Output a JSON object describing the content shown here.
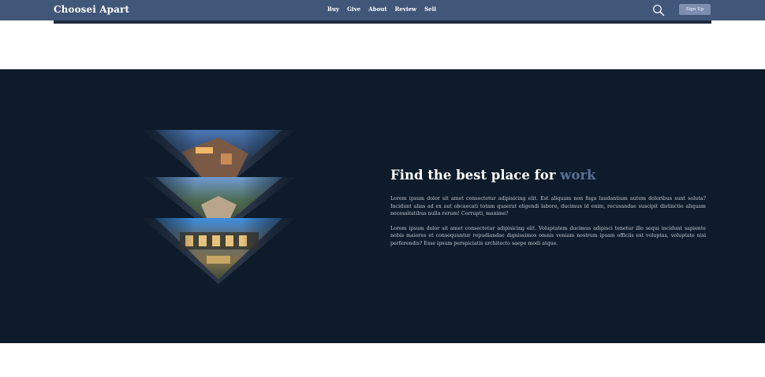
{
  "navbar": {
    "brand": "Choosei Apart",
    "links": [
      "Buy",
      "Give",
      "About",
      "Review",
      "Sell"
    ],
    "signup_label": "Sign Up",
    "icon": "search-icon"
  },
  "hero": {
    "heading_main": "Find the best place for ",
    "heading_accent": "work",
    "paragraph_1": "Lorem ipsum dolor sit amet consectetur adipisicing elit. Est aliquam non fuga laudantium autem doloribus sunt soluta? Incidunt alias ad ex aut obcaecati totam quaerat eligendi labore, ducimus id enim, recusandae suscipit distinctio aliquam necessitatibus nulla rerum! Corrupti, maxime?",
    "paragraph_2": "Lorem ipsum dolor sit amet consectetur adipisicing elit. Voluptatem ducimus adipisci tenetur illo sequi incidunt sapiente nobis maiores et consequuntur repudiandae dignissimos omnis veniam nostrum ipsam officiis est voluptas, voluptate nisi perferendis? Esse ipsum perspiciatis architecto saepe modi atque."
  },
  "colors": {
    "navbar_bg": "#41577a",
    "hero_bg": "#0d1b2a",
    "accent": "#5a7196",
    "signup_bg": "#7d8eb0"
  }
}
